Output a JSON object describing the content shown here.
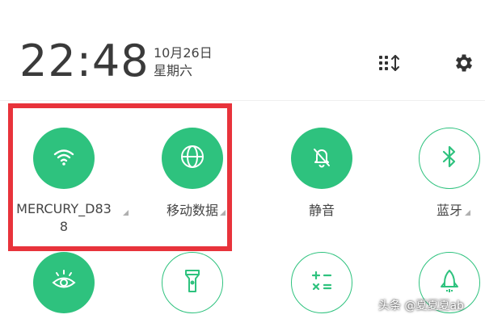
{
  "status": {
    "time": "22:48",
    "date": "10月26日",
    "weekday": "星期六"
  },
  "header_icons": {
    "edit": "edit-tiles-icon",
    "settings": "gear-icon"
  },
  "tiles_row1": [
    {
      "label": "MERCURY_D83",
      "label_line2": "8",
      "icon": "wifi-icon",
      "state": "on"
    },
    {
      "label": "移动数据",
      "icon": "globe-icon",
      "state": "on"
    },
    {
      "label": "静音",
      "icon": "bell-off-icon",
      "state": "on"
    },
    {
      "label": "蓝牙",
      "icon": "bluetooth-icon",
      "state": "off"
    }
  ],
  "tiles_row2": [
    {
      "icon": "eye-comfort-icon",
      "state": "on"
    },
    {
      "icon": "flashlight-icon",
      "state": "off"
    },
    {
      "icon": "calculator-icon",
      "state": "off"
    },
    {
      "icon": "rocket-icon",
      "state": "off"
    }
  ],
  "colors": {
    "accent": "#2ec27e",
    "highlight": "#e8333b"
  },
  "watermark": "头条 @夏夏夏ab"
}
